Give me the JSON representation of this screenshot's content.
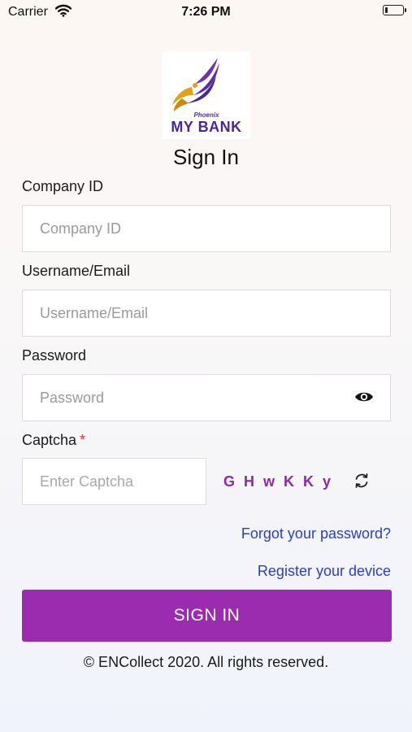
{
  "status_bar": {
    "carrier": "Carrier",
    "time": "7:26 PM"
  },
  "logo": {
    "small_text": "Phoenix",
    "big_text": "MY BANK",
    "colors": {
      "purple": "#4a2799",
      "gold": "#e0a21a"
    }
  },
  "title": "Sign In",
  "form": {
    "company_id": {
      "label": "Company ID",
      "placeholder": "Company ID",
      "value": ""
    },
    "username": {
      "label": "Username/Email",
      "placeholder": "Username/Email",
      "value": ""
    },
    "password": {
      "label": "Password",
      "placeholder": "Password",
      "value": "",
      "toggle_icon": "eye-icon"
    },
    "captcha": {
      "label": "Captcha",
      "required_mark": "*",
      "placeholder": "Enter Captcha",
      "value": "",
      "code": "G H w K K y",
      "refresh_icon": "refresh-icon"
    }
  },
  "links": {
    "forgot_password": "Forgot your password?",
    "register_device": "Register your device"
  },
  "sign_in_button": "SIGN IN",
  "footer": "© ENCollect 2020. All rights reserved.",
  "colors": {
    "accent": "#9b2cb0",
    "link": "#2a3fc7",
    "captcha_code": "#8a2aa8",
    "required": "#e2333a"
  }
}
